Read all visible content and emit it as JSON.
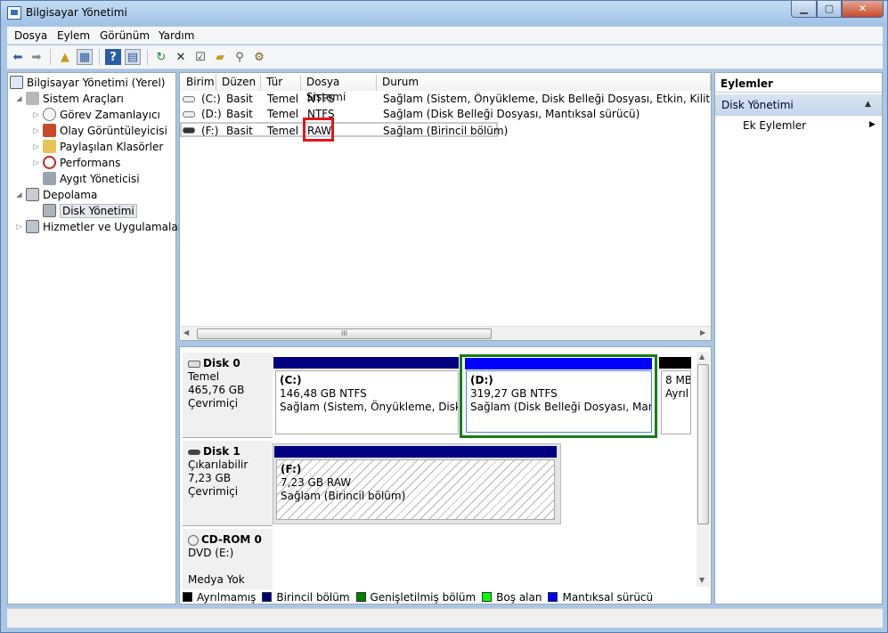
{
  "window": {
    "title": "Bilgisayar Yönetimi",
    "min": "▁",
    "max": "▢",
    "close": "✕"
  },
  "menu": [
    "Dosya",
    "Eylem",
    "Görünüm",
    "Yardım"
  ],
  "tree": {
    "root": "Bilgisayar Yönetimi (Yerel)",
    "sistem": "Sistem Araçları",
    "gorev": "Görev Zamanlayıcı",
    "olay": "Olay Görüntüleyicisi",
    "paylasilan": "Paylaşılan Klasörler",
    "performans": "Performans",
    "aygit": "Aygıt Yöneticisi",
    "depolama": "Depolama",
    "disk": "Disk Yönetimi",
    "hizmetler": "Hizmetler ve Uygulamalar"
  },
  "volumes": {
    "columns": [
      "Birim",
      "Düzen",
      "Tür",
      "Dosya Sistemi",
      "Durum"
    ],
    "rows": [
      {
        "birim": "(C:)",
        "duzen": "Basit",
        "tur": "Temel",
        "fs": "NTFS",
        "durum": "Sağlam (Sistem, Önyükleme, Disk Belleği Dosyası, Etkin, Kilitlenme Bilg"
      },
      {
        "birim": "(D:)",
        "duzen": "Basit",
        "tur": "Temel",
        "fs": "NTFS",
        "durum": "Sağlam (Disk Belleği Dosyası, Mantıksal sürücü)"
      },
      {
        "birim": "(F:)",
        "duzen": "Basit",
        "tur": "Temel",
        "fs": "RAW",
        "durum": "Sağlam (Birincil bölüm)"
      }
    ],
    "scroll_grip": "III"
  },
  "disks": [
    {
      "name": "Disk 0",
      "type": "Temel",
      "size": "465,76 GB",
      "state": "Çevrimiçi",
      "parts": [
        {
          "label": "(C:)",
          "size": "146,48 GB NTFS",
          "status": "Sağlam (Sistem, Önyükleme, Disk Be"
        },
        {
          "label": "(D:)",
          "size": "319,27 GB NTFS",
          "status": "Sağlam (Disk Belleği Dosyası, Mantıksa"
        },
        {
          "label": "",
          "size": "8 MB",
          "status": "Ayrıl"
        }
      ]
    },
    {
      "name": "Disk 1",
      "type": "Çıkarılabilir",
      "size": "7,23 GB",
      "state": "Çevrimiçi",
      "parts": [
        {
          "label": "(F:)",
          "size": "7,23 GB RAW",
          "status": "Sağlam (Birincil bölüm)"
        }
      ]
    },
    {
      "name": "CD-ROM 0",
      "type": "DVD (E:)",
      "size": "",
      "state": "Medya Yok"
    }
  ],
  "legend": [
    {
      "label": "Ayrılmamış",
      "color": "#000000"
    },
    {
      "label": "Birincil bölüm",
      "color": "#000080"
    },
    {
      "label": "Genişletilmiş bölüm",
      "color": "#008000"
    },
    {
      "label": "Boş alan",
      "color": "#00ff00"
    },
    {
      "label": "Mantıksal sürücü",
      "color": "#0000ff"
    }
  ],
  "actions": {
    "title": "Eylemler",
    "section": "Disk Yönetimi",
    "item": "Ek Eylemler"
  }
}
